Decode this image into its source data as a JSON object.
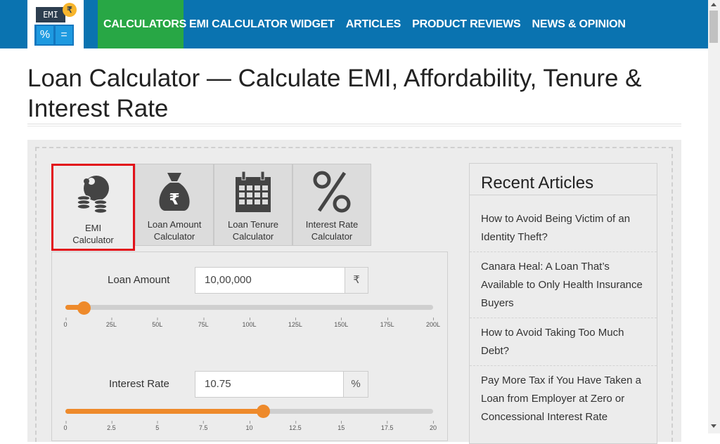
{
  "logo": {
    "screen_text": "EMI",
    "coin_symbol": "₹",
    "key_left": "%",
    "key_right": "="
  },
  "nav": {
    "items": [
      {
        "label": "CALCULATORS",
        "has_caret": true
      },
      {
        "label": "EMI CALCULATOR WIDGET"
      },
      {
        "label": "ARTICLES"
      },
      {
        "label": "PRODUCT REVIEWS"
      },
      {
        "label": "NEWS & OPINION"
      }
    ]
  },
  "page": {
    "title": "Loan Calculator — Calculate EMI, Affordability, Tenure & Interest Rate"
  },
  "tabs": [
    {
      "label_line1": "EMI",
      "label_line2": "Calculator",
      "icon": "coins-icon",
      "active": true
    },
    {
      "label_line1": "Loan Amount",
      "label_line2": "Calculator",
      "icon": "money-bag-icon",
      "active": false
    },
    {
      "label_line1": "Loan Tenure",
      "label_line2": "Calculator",
      "icon": "calendar-icon",
      "active": false
    },
    {
      "label_line1": "Interest Rate",
      "label_line2": "Calculator",
      "icon": "percent-icon",
      "active": false
    }
  ],
  "loan_amount": {
    "label": "Loan Amount",
    "value": "10,00,000",
    "unit": "₹",
    "slider_fraction": 0.05,
    "ticks": [
      "0",
      "25L",
      "50L",
      "75L",
      "100L",
      "125L",
      "150L",
      "175L",
      "200L"
    ]
  },
  "interest_rate": {
    "label": "Interest Rate",
    "value": "10.75",
    "unit": "%",
    "slider_fraction": 0.5375,
    "ticks": [
      "0",
      "2.5",
      "5",
      "7.5",
      "10",
      "12.5",
      "15",
      "17.5",
      "20"
    ]
  },
  "sidebar": {
    "title": "Recent Articles",
    "articles": [
      "How to Avoid Being Victim of an Identity Theft?",
      "Canara Heal: A Loan That’s Available to Only Health Insurance Buyers",
      "How to Avoid Taking Too Much Debt?",
      "Pay More Tax if You Have Taken a Loan from Employer at Zero or Concessional Interest Rate"
    ]
  },
  "colors": {
    "nav_bg": "#0a73b0",
    "nav_active": "#28a745",
    "slider": "#ee8a2b",
    "active_tab_border": "#e2121a"
  }
}
